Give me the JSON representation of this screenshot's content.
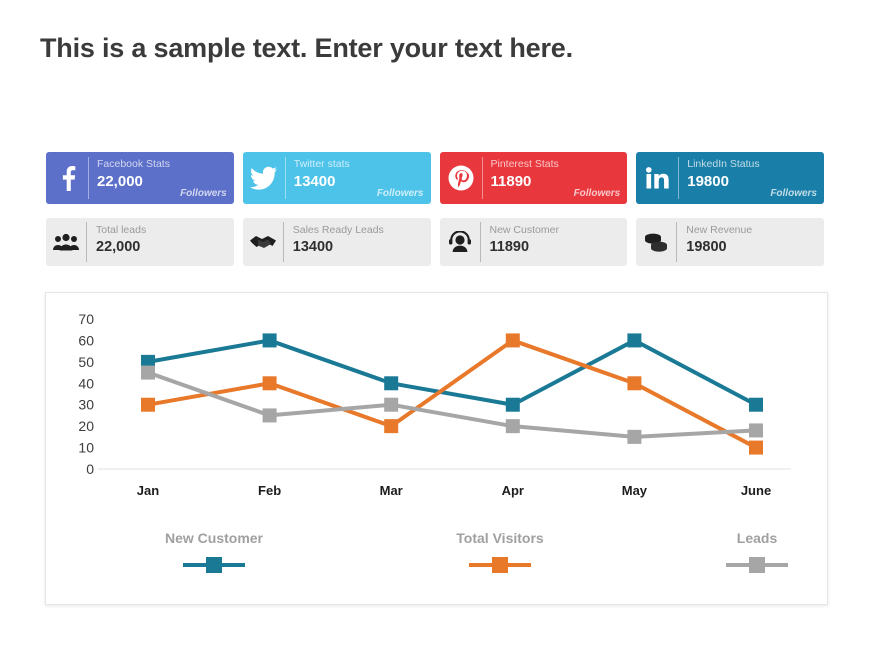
{
  "page": {
    "title": "This is a sample text. Enter your text here.",
    "background": "#ffffff"
  },
  "social_cards": [
    {
      "name": "facebook",
      "icon": "facebook-icon",
      "label": "Facebook Stats",
      "value": "22,000",
      "unit": "Followers",
      "color": "#5c6fc9"
    },
    {
      "name": "twitter",
      "icon": "twitter-icon",
      "label": "Twitter stats",
      "value": "13400",
      "unit": "Followers",
      "color": "#4ec3ea"
    },
    {
      "name": "pinterest",
      "icon": "pinterest-icon",
      "label": "Pinterest Stats",
      "value": "11890",
      "unit": "Followers",
      "color": "#e8373d"
    },
    {
      "name": "linkedin",
      "icon": "linkedin-icon",
      "label": "LinkedIn Status",
      "value": "19800",
      "unit": "Followers",
      "color": "#1a7fa8"
    }
  ],
  "stat_cards": [
    {
      "name": "total-leads",
      "icon": "people-group-icon",
      "label": "Total leads",
      "value": "22,000"
    },
    {
      "name": "sales-ready-leads",
      "icon": "handshake-icon",
      "label": "Sales Ready Leads",
      "value": "13400"
    },
    {
      "name": "new-customer",
      "icon": "headset-agent-icon",
      "label": "New Customer",
      "value": "11890"
    },
    {
      "name": "new-revenue",
      "icon": "coins-stack-icon",
      "label": "New Revenue",
      "value": "19800"
    }
  ],
  "chart_data": {
    "type": "line",
    "title": "",
    "xlabel": "",
    "ylabel": "",
    "categories": [
      "Jan",
      "Feb",
      "Mar",
      "Apr",
      "May",
      "June"
    ],
    "ylim": [
      0,
      70
    ],
    "yticks": [
      0,
      10,
      20,
      30,
      40,
      50,
      60,
      70
    ],
    "grid": false,
    "legend_position": "bottom",
    "markers": "square",
    "series": [
      {
        "name": "New Customer",
        "color": "#1a7a96",
        "values": [
          50,
          60,
          40,
          30,
          60,
          30
        ]
      },
      {
        "name": "Total Visitors",
        "color": "#e8792b",
        "values": [
          30,
          40,
          20,
          60,
          40,
          10
        ]
      },
      {
        "name": "Leads",
        "color": "#a6a6a6",
        "values": [
          45,
          25,
          30,
          20,
          15,
          18
        ]
      }
    ]
  }
}
